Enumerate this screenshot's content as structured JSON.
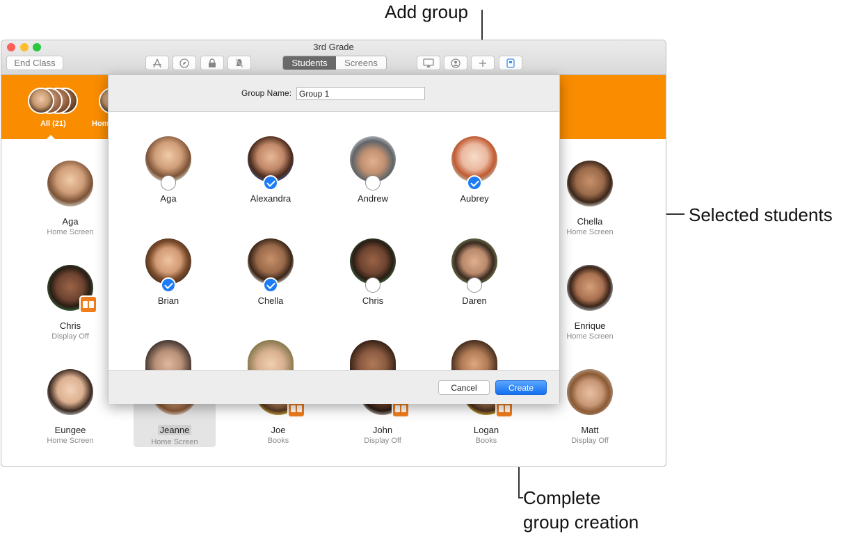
{
  "callouts": {
    "add_group": "Add group",
    "selected_students": "Selected students",
    "complete_line1": "Complete",
    "complete_line2": "group creation"
  },
  "window": {
    "title": "3rd Grade",
    "end_class_label": "End Class",
    "tabs": [
      {
        "label": "Students",
        "selected": true
      },
      {
        "label": "Screens",
        "selected": false
      }
    ],
    "toolbar_icons": [
      "apps-icon",
      "safari-icon",
      "lock-icon",
      "mute-icon",
      "airplay-icon",
      "person-icon",
      "plus-icon",
      "screen-icon"
    ]
  },
  "groups": {
    "all_label": "All (21)",
    "second_label": "Home"
  },
  "background_students": [
    {
      "name": "Aga",
      "status": "Home Screen"
    },
    {
      "name": "Chella",
      "status": "Home Screen"
    },
    {
      "name": "Chris",
      "status": "Display Off"
    },
    {
      "name": "Enrique",
      "status": "Home Screen"
    },
    {
      "name": "Eungee",
      "status": "Home Screen"
    },
    {
      "name": "Jeanne",
      "status": "Home Screen"
    },
    {
      "name": "Joe",
      "status": "Books"
    },
    {
      "name": "John",
      "status": "Display Off"
    },
    {
      "name": "Logan",
      "status": "Books"
    },
    {
      "name": "Matt",
      "status": "Display Off"
    }
  ],
  "sheet": {
    "group_name_label": "Group Name:",
    "group_name_value": "Group 1",
    "cancel_label": "Cancel",
    "create_label": "Create",
    "students": [
      {
        "name": "Aga",
        "selected": false
      },
      {
        "name": "Alexandra",
        "selected": true
      },
      {
        "name": "Andrew",
        "selected": false
      },
      {
        "name": "Aubrey",
        "selected": true
      },
      {
        "name": "Brian",
        "selected": true
      },
      {
        "name": "Chella",
        "selected": true
      },
      {
        "name": "Chris",
        "selected": false
      },
      {
        "name": "Daren",
        "selected": false
      }
    ]
  },
  "colors": {
    "accent_orange": "#fa8c00",
    "selection_blue": "#1b7cf5"
  }
}
